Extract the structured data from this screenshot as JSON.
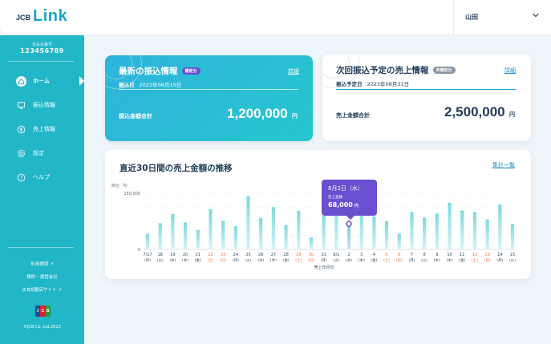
{
  "header": {
    "logo_prefix": "JCB",
    "logo_text": "Link",
    "user_name": "山田"
  },
  "sidebar": {
    "account_label": "支払先番号",
    "account_number": "123456789",
    "nav": [
      {
        "label": "ホーム",
        "icon": "home-icon",
        "active": true
      },
      {
        "label": "振込情報",
        "icon": "transfer-icon",
        "active": false
      },
      {
        "label": "売上情報",
        "icon": "yen-icon",
        "active": false
      },
      {
        "label": "設定",
        "icon": "gear-icon",
        "active": false
      },
      {
        "label": "ヘルプ",
        "icon": "help-icon",
        "active": false
      }
    ],
    "links": [
      {
        "label": "利用環境",
        "icon": "external-link-icon"
      },
      {
        "label": "規約・運営会社",
        "icon": ""
      },
      {
        "label": "JCB加盟店サイト",
        "icon": "external-link-icon"
      }
    ],
    "copyright": "©JCB Co.,Ltd.2023"
  },
  "latest_transfer": {
    "title": "最新の振込情報",
    "badge": "確定分",
    "detail_link": "詳細",
    "date_label": "振込日",
    "date": "2023年08月15日",
    "total_label": "振込金額合計",
    "total_value": "1,200,000",
    "unit": "円"
  },
  "next_transfer": {
    "title": "次回振込予定の売上情報",
    "badge": "未確定分",
    "detail_link": "詳細",
    "date_label": "振込予定日",
    "date": "2023年08月31日",
    "total_label": "売上金額合計",
    "total_value": "2,500,000",
    "unit": "円"
  },
  "sales_chart": {
    "title": "直近30日間の売上金額の推移",
    "list_link": "集計一覧",
    "tooltip": {
      "date": "8月2日（水）",
      "label": "売上金額",
      "value": "68,000",
      "unit": "円"
    }
  },
  "chart_data": {
    "type": "bar",
    "unit_label": "（単位：円）",
    "xlabel": "売上年月日",
    "y_ticks": [
      "150,000",
      "0"
    ],
    "ylim": [
      0,
      150000
    ],
    "categories": [
      "7/17",
      "18",
      "19",
      "20",
      "21",
      "22",
      "23",
      "24",
      "25",
      "26",
      "27",
      "28",
      "29",
      "30",
      "31",
      "8/1",
      "2",
      "3",
      "4",
      "5",
      "6",
      "7",
      "8",
      "9",
      "10",
      "11",
      "12",
      "13",
      "14",
      "15"
    ],
    "weekdays": [
      "(月)",
      "(火)",
      "(水)",
      "(木)",
      "(金)",
      "(土)",
      "(日)",
      "(月)",
      "(火)",
      "(水)",
      "(木)",
      "(金)",
      "(土)",
      "(日)",
      "(月)",
      "(火)",
      "(水)",
      "(木)",
      "(金)",
      "(土)",
      "(日)",
      "(月)",
      "(火)",
      "(水)",
      "(木)",
      "(金)",
      "(土)",
      "(日)",
      "(月)",
      "(火)"
    ],
    "weekend": [
      false,
      false,
      false,
      false,
      false,
      true,
      true,
      false,
      false,
      false,
      false,
      false,
      true,
      true,
      false,
      false,
      false,
      false,
      false,
      true,
      true,
      false,
      false,
      false,
      false,
      false,
      true,
      true,
      false,
      false
    ],
    "values": [
      42000,
      70000,
      95000,
      72000,
      52000,
      108000,
      76000,
      62000,
      142000,
      84000,
      113000,
      65000,
      103000,
      32000,
      90000,
      120000,
      68000,
      109000,
      88000,
      76000,
      42000,
      100000,
      85000,
      96000,
      125000,
      104000,
      100000,
      80000,
      120000,
      68000
    ],
    "highlight_index": 16,
    "colors": {
      "bar_top": "#7ed9de",
      "bar_bottom": "#d7f3f5",
      "weekend_label": "#e8733a",
      "highlight": "#6a4fd0"
    }
  }
}
